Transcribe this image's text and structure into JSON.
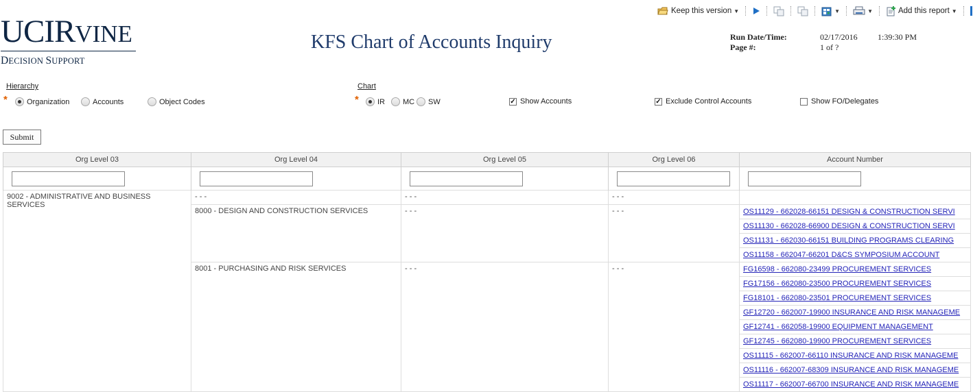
{
  "toolbar": {
    "keep_version": "Keep this version",
    "add_report": "Add this report"
  },
  "header": {
    "logo_main_uc": "UCI",
    "logo_main_r": "R",
    "logo_main_rest": "VINE",
    "logo_sub_d": "D",
    "logo_sub_ecision": "ECISION ",
    "logo_sub_s": "S",
    "logo_sub_upport": "UPPORT",
    "title": "KFS Chart of Accounts Inquiry",
    "run_label": "Run Date/Time:",
    "run_date": "02/17/2016",
    "run_time": "1:39:30 PM",
    "page_label": "Page #:",
    "page_value": "1 of ?"
  },
  "filters": {
    "hierarchy_label": "Hierarchy",
    "hierarchy_options": [
      "Organization",
      "Accounts",
      "Object Codes"
    ],
    "hierarchy_selected": "Organization",
    "chart_label": "Chart",
    "chart_options": [
      "IR",
      "MC",
      "SW"
    ],
    "chart_selected": "IR",
    "show_accounts": "Show Accounts",
    "show_accounts_checked": true,
    "exclude_control": "Exclude Control Accounts",
    "exclude_control_checked": true,
    "show_fo": "Show FO/Delegates",
    "show_fo_checked": false,
    "submit": "Submit"
  },
  "grid": {
    "columns": [
      "Org Level 03",
      "Org Level 04",
      "Org Level 05",
      "Org Level 06",
      "Account Number"
    ],
    "dash": "- - -",
    "l3_org": "9002 - ADMINISTRATIVE AND BUSINESS SERVICES",
    "groups": [
      {
        "l4": "8000 - DESIGN AND CONSTRUCTION SERVICES",
        "accounts": [
          "OS11129 - 662028-66151 DESIGN & CONSTRUCTION SERVI",
          "OS11130 - 662028-66900 DESIGN & CONSTRUCTION SERVI",
          "OS11131 - 662030-66151 BUILDING PROGRAMS CLEARING",
          "OS11158 - 662047-66201 D&CS SYMPOSIUM ACCOUNT"
        ]
      },
      {
        "l4": "8001 - PURCHASING AND RISK SERVICES",
        "accounts": [
          "FG16598 - 662080-23499 PROCUREMENT SERVICES",
          "FG17156 - 662080-23500 PROCUREMENT SERVICES",
          "FG18101 - 662080-23501 PROCUREMENT SERVICES",
          "GF12720 - 662007-19900 INSURANCE AND RISK MANAGEME",
          "GF12741 - 662058-19900 EQUIPMENT MANAGEMENT",
          "GF12745 - 662080-19900 PROCUREMENT SERVICES",
          "OS11115 - 662007-66110 INSURANCE AND RISK MANAGEME",
          "OS11116 - 662007-68309 INSURANCE AND RISK MANAGEME",
          "OS11117 - 662007-66700 INSURANCE AND RISK MANAGEME"
        ]
      }
    ]
  },
  "colors": {
    "brand_navy": "#0f2644",
    "title_blue": "#1f3b6b",
    "link": "#2323b8",
    "required": "#e06000"
  },
  "icons": [
    "keep-version-icon",
    "run-icon",
    "copy-icon",
    "copy-icon-2",
    "export-icon",
    "print-icon",
    "add-report-icon"
  ]
}
